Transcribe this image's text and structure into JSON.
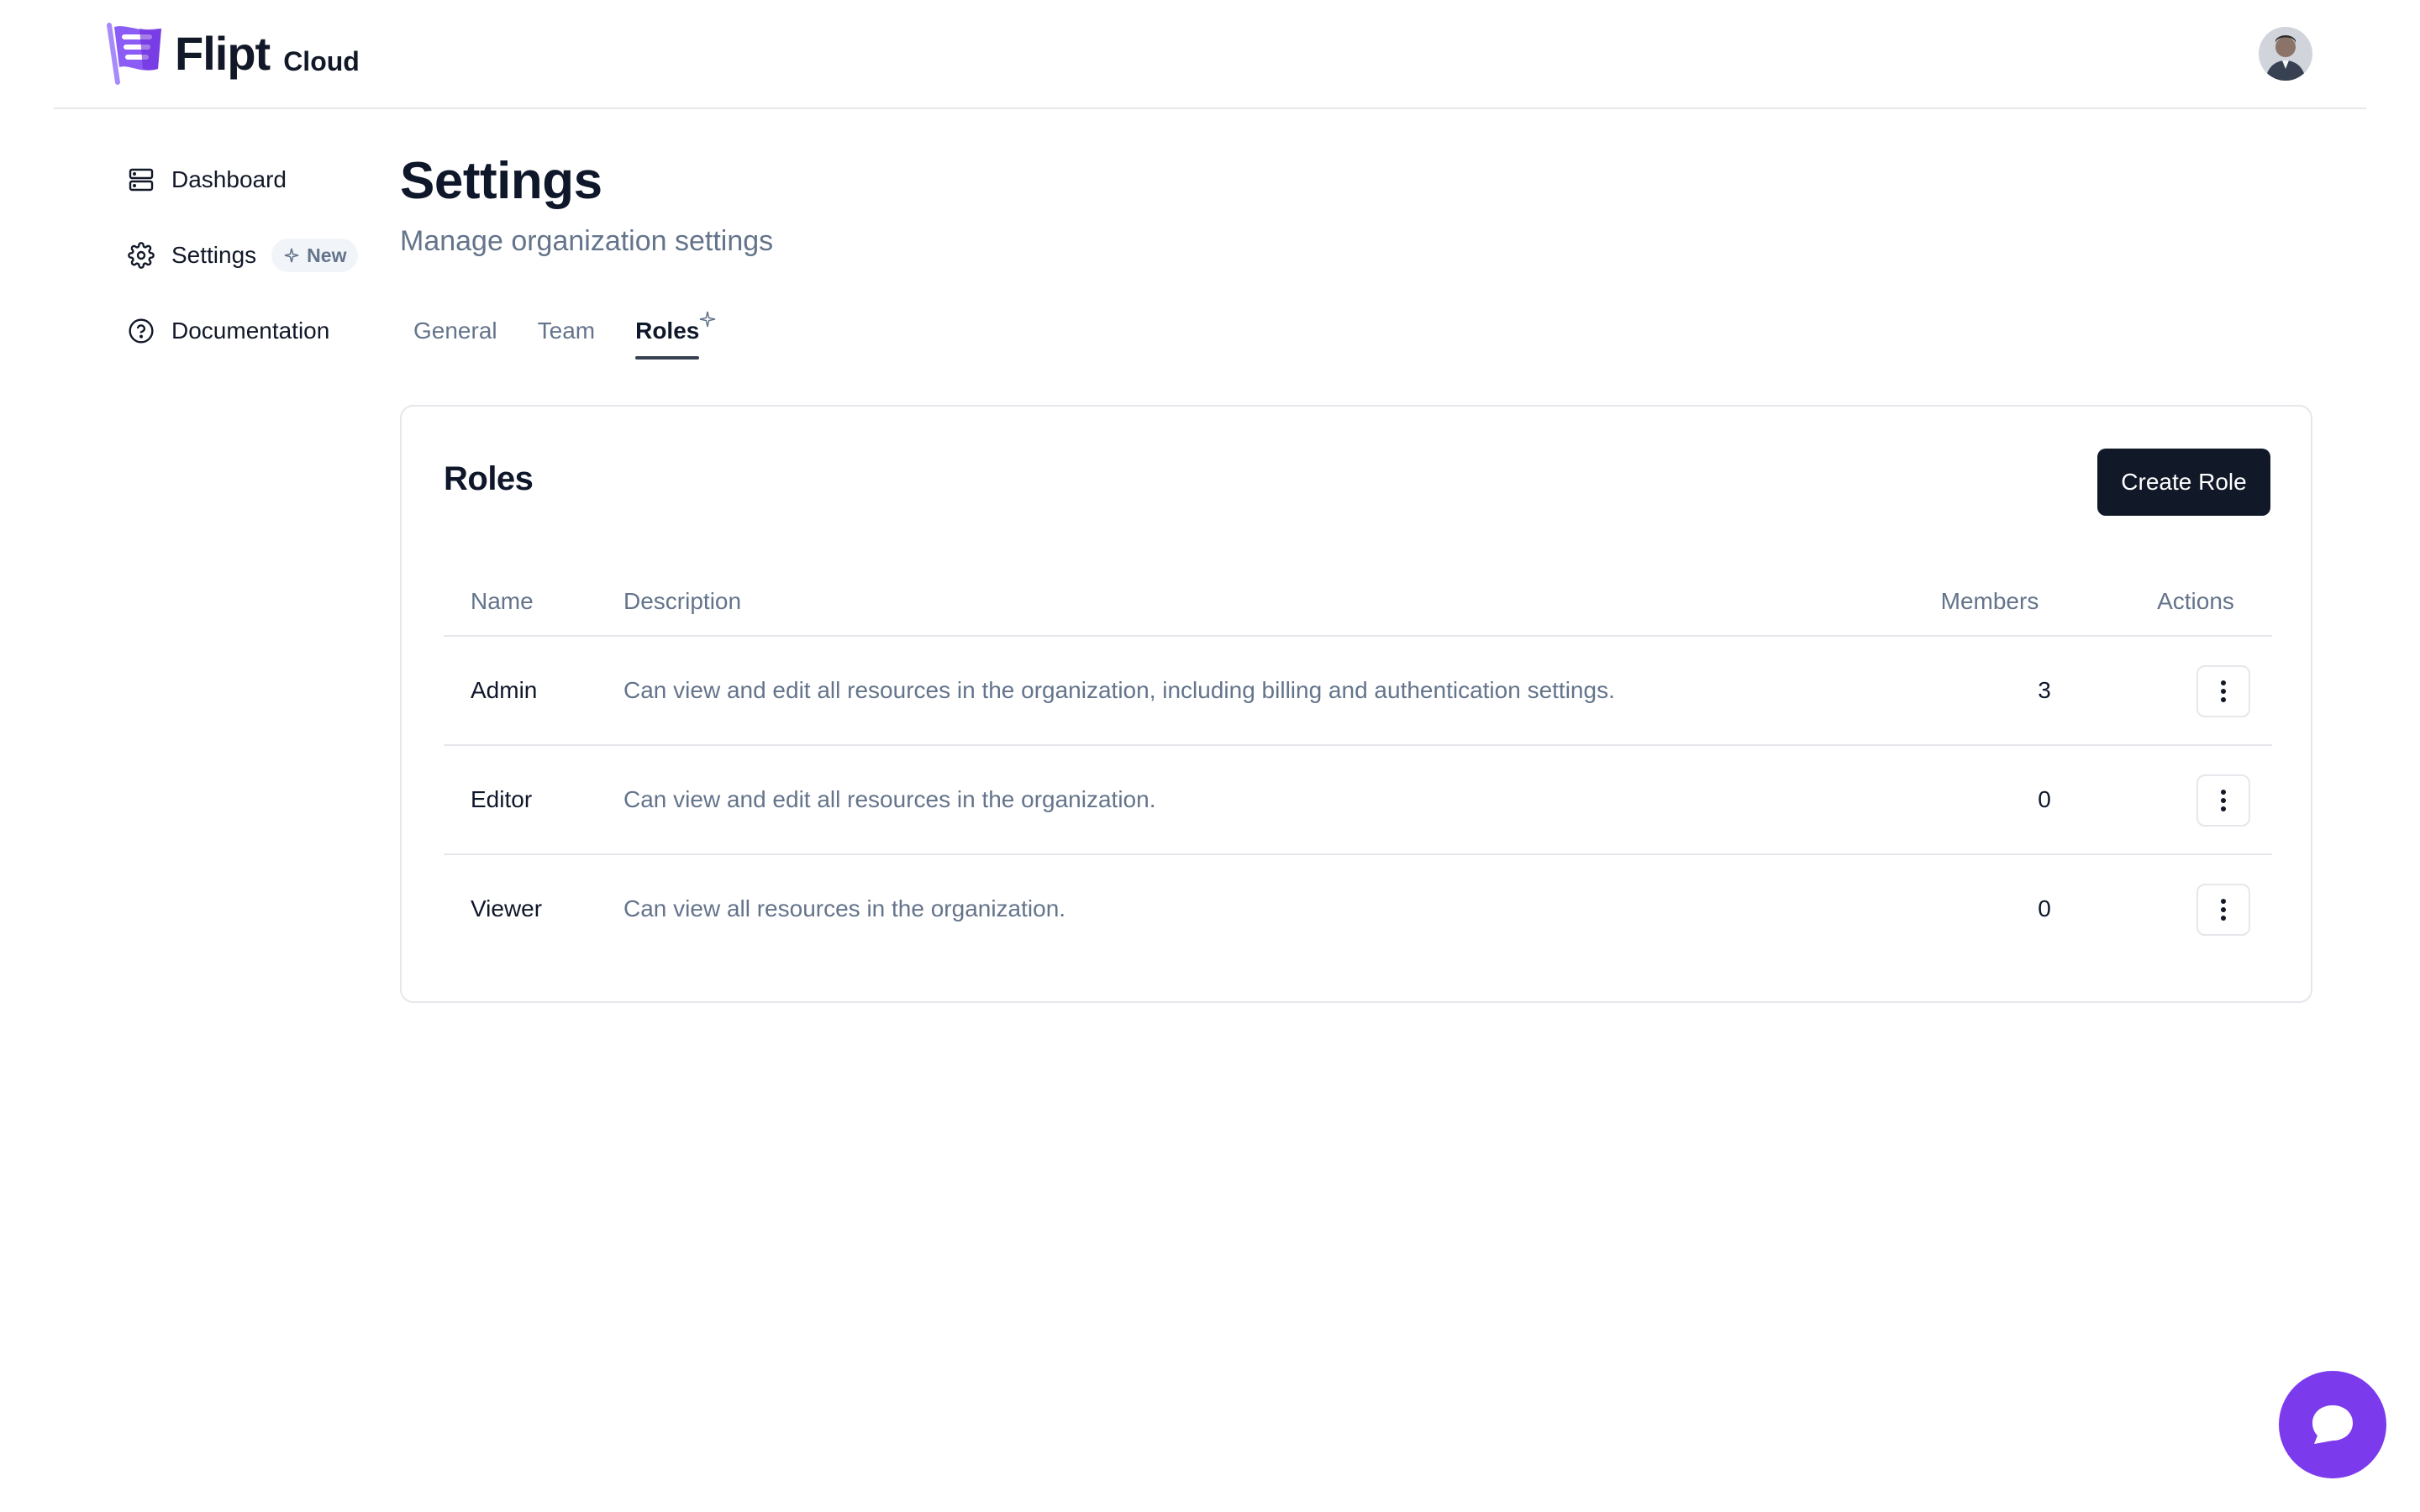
{
  "brand": {
    "name": "Flipt",
    "suffix": "Cloud",
    "accent": "#7c3aed"
  },
  "sidebar": {
    "items": [
      {
        "label": "Dashboard",
        "icon": "server-icon"
      },
      {
        "label": "Settings",
        "icon": "gear-icon",
        "badge": "New"
      },
      {
        "label": "Documentation",
        "icon": "help-circle-icon"
      }
    ]
  },
  "page": {
    "title": "Settings",
    "subtitle": "Manage organization settings"
  },
  "tabs": [
    {
      "label": "General"
    },
    {
      "label": "Team"
    },
    {
      "label": "Roles",
      "active": true
    }
  ],
  "roles_card": {
    "title": "Roles",
    "create_label": "Create Role",
    "columns": [
      "Name",
      "Description",
      "Members",
      "Actions"
    ],
    "rows": [
      {
        "name": "Admin",
        "description": "Can view and edit all resources in the organization, including billing and authentication settings.",
        "members": "3"
      },
      {
        "name": "Editor",
        "description": "Can view and edit all resources in the organization.",
        "members": "0"
      },
      {
        "name": "Viewer",
        "description": "Can view all resources in the organization.",
        "members": "0"
      }
    ]
  }
}
